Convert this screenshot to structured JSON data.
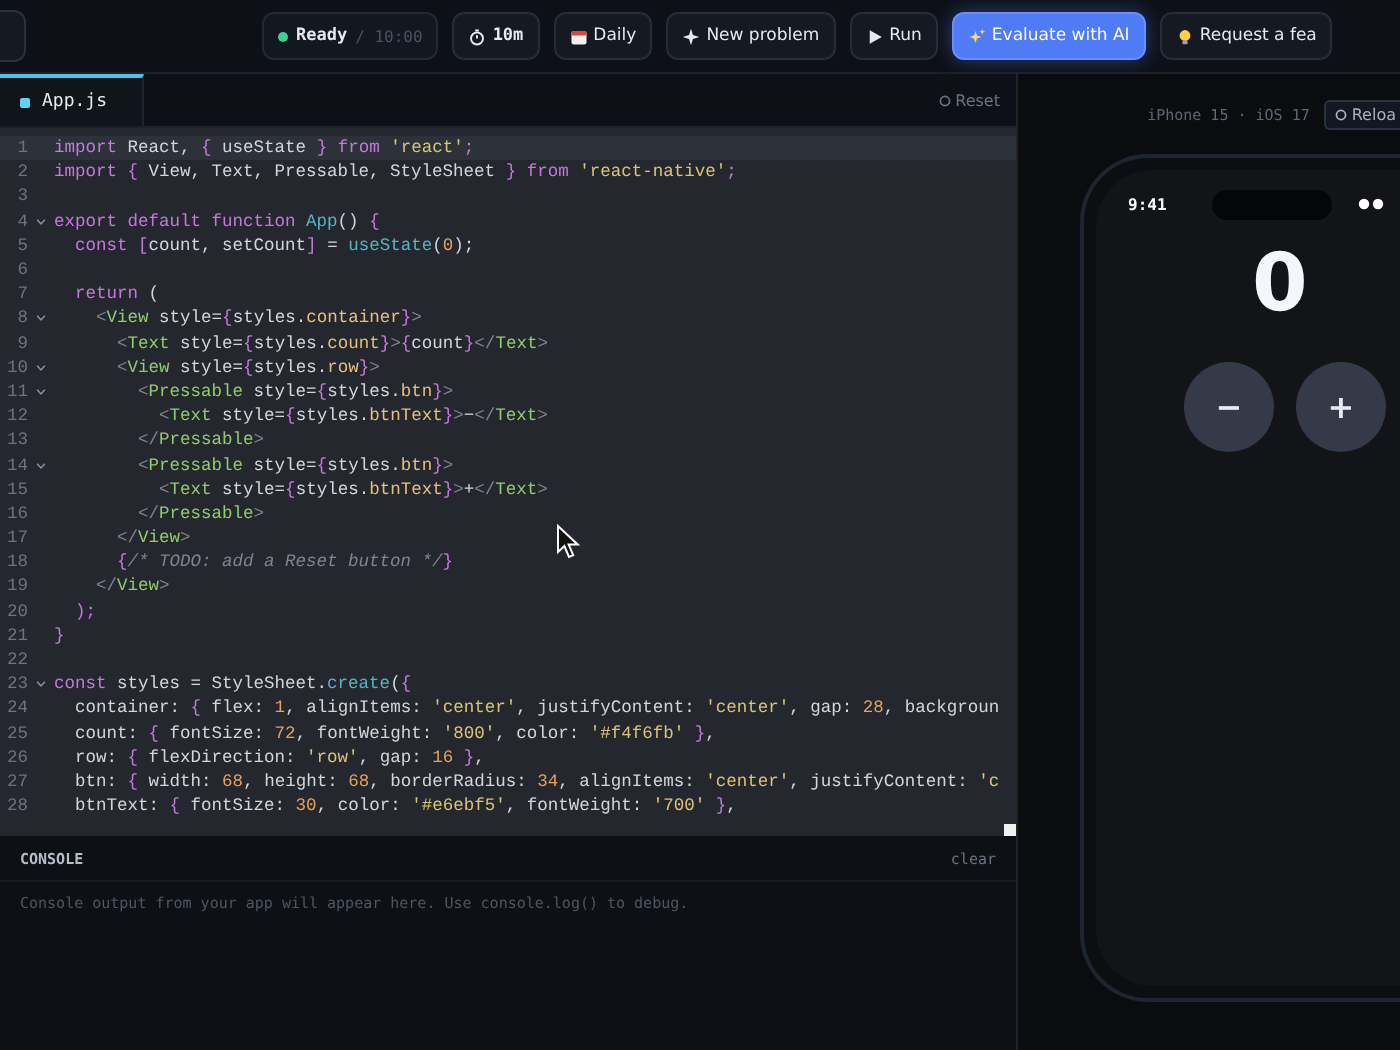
{
  "toolbar": {
    "status": {
      "label": "Ready",
      "limit": "/ 10:00",
      "color": "#3ecf8e"
    },
    "buttons": [
      {
        "label": "10m",
        "kind": "mono"
      },
      {
        "label": "Daily",
        "kind": "plain"
      },
      {
        "label": "New problem",
        "kind": "plain"
      },
      {
        "label": "Run",
        "kind": "plain"
      },
      {
        "label": "Evaluate with AI",
        "kind": "primary"
      },
      {
        "label": "Request a fea",
        "kind": "plain"
      }
    ]
  },
  "editor": {
    "tabs": [
      {
        "label": "App.js",
        "selected": true
      }
    ],
    "reset": "Reset",
    "lines": [
      {
        "n": "1",
        "fold": false,
        "current": true,
        "tokens": [
          {
            "kind": "k",
            "text": "import "
          },
          {
            "kind": "i",
            "text": "React, "
          },
          {
            "kind": "p",
            "text": "{ "
          },
          {
            "kind": "i",
            "text": "useState "
          },
          {
            "kind": "p",
            "text": "} "
          },
          {
            "kind": "k",
            "text": "from "
          },
          {
            "kind": "s",
            "text": "'react'"
          },
          {
            "kind": "p",
            "text": ";"
          }
        ]
      },
      {
        "n": "2",
        "fold": false,
        "current": false,
        "tokens": [
          {
            "kind": "k",
            "text": "import "
          },
          {
            "kind": "p",
            "text": "{ "
          },
          {
            "kind": "i",
            "text": "View, Text, Pressable, StyleSheet "
          },
          {
            "kind": "p",
            "text": "} "
          },
          {
            "kind": "k",
            "text": "from "
          },
          {
            "kind": "s",
            "text": "'react-native'"
          },
          {
            "kind": "p",
            "text": ";"
          }
        ]
      },
      {
        "n": "3",
        "fold": false,
        "current": false
      },
      {
        "n": "4",
        "fold": true,
        "current": false,
        "tokens": [
          {
            "kind": "k",
            "text": "export default function "
          },
          {
            "kind": "f",
            "text": "App"
          },
          {
            "kind": "i",
            "text": "() "
          },
          {
            "kind": "p",
            "text": "{"
          }
        ]
      },
      {
        "n": "5",
        "fold": false,
        "current": false,
        "tokens": [
          {
            "kind": "k",
            "text": "  const "
          },
          {
            "kind": "p",
            "text": "["
          },
          {
            "kind": "i",
            "text": "count, setCount"
          },
          {
            "kind": "p",
            "text": "] "
          },
          {
            "kind": "i",
            "text": "= "
          },
          {
            "kind": "f",
            "text": "useState"
          },
          {
            "kind": "i",
            "text": "("
          },
          {
            "kind": "n",
            "text": "0"
          },
          {
            "kind": "i",
            "text": ");"
          }
        ]
      },
      {
        "n": "6",
        "fold": false,
        "current": false
      },
      {
        "n": "7",
        "fold": false,
        "current": false,
        "tokens": [
          {
            "kind": "k",
            "text": "  return "
          },
          {
            "kind": "i",
            "text": "("
          }
        ]
      },
      {
        "n": "8",
        "fold": true,
        "current": false,
        "tokens": [
          {
            "kind": "a",
            "text": "    <"
          },
          {
            "kind": "t",
            "text": "View "
          },
          {
            "kind": "i",
            "text": "style="
          },
          {
            "kind": "p",
            "text": "{"
          },
          {
            "kind": "i",
            "text": "styles."
          },
          {
            "kind": "y",
            "text": "container"
          },
          {
            "kind": "p",
            "text": "}"
          },
          {
            "kind": "a",
            "text": ">"
          }
        ]
      },
      {
        "n": "9",
        "fold": false,
        "current": false,
        "tokens": [
          {
            "kind": "a",
            "text": "      <"
          },
          {
            "kind": "t",
            "text": "Text "
          },
          {
            "kind": "i",
            "text": "style="
          },
          {
            "kind": "p",
            "text": "{"
          },
          {
            "kind": "i",
            "text": "styles."
          },
          {
            "kind": "y",
            "text": "count"
          },
          {
            "kind": "p",
            "text": "}"
          },
          {
            "kind": "a",
            "text": ">"
          },
          {
            "kind": "p",
            "text": "{"
          },
          {
            "kind": "i",
            "text": "count"
          },
          {
            "kind": "p",
            "text": "}"
          },
          {
            "kind": "a",
            "text": "</"
          },
          {
            "kind": "t",
            "text": "Text"
          },
          {
            "kind": "a",
            "text": ">"
          }
        ]
      },
      {
        "n": "10",
        "fold": true,
        "current": false,
        "tokens": [
          {
            "kind": "a",
            "text": "      <"
          },
          {
            "kind": "t",
            "text": "View "
          },
          {
            "kind": "i",
            "text": "style="
          },
          {
            "kind": "p",
            "text": "{"
          },
          {
            "kind": "i",
            "text": "styles."
          },
          {
            "kind": "y",
            "text": "row"
          },
          {
            "kind": "p",
            "text": "}"
          },
          {
            "kind": "a",
            "text": ">"
          }
        ]
      },
      {
        "n": "11",
        "fold": true,
        "current": false,
        "tokens": [
          {
            "kind": "a",
            "text": "        <"
          },
          {
            "kind": "t",
            "text": "Pressable "
          },
          {
            "kind": "i",
            "text": "style="
          },
          {
            "kind": "p",
            "text": "{"
          },
          {
            "kind": "i",
            "text": "styles."
          },
          {
            "kind": "y",
            "text": "btn"
          },
          {
            "kind": "p",
            "text": "}"
          },
          {
            "kind": "a",
            "text": ">"
          }
        ]
      },
      {
        "n": "12",
        "fold": false,
        "current": false,
        "tokens": [
          {
            "kind": "a",
            "text": "          <"
          },
          {
            "kind": "t",
            "text": "Text "
          },
          {
            "kind": "i",
            "text": "style="
          },
          {
            "kind": "p",
            "text": "{"
          },
          {
            "kind": "i",
            "text": "styles."
          },
          {
            "kind": "y",
            "text": "btnText"
          },
          {
            "kind": "p",
            "text": "}"
          },
          {
            "kind": "a",
            "text": ">"
          },
          {
            "kind": "i",
            "text": "−"
          },
          {
            "kind": "a",
            "text": "</"
          },
          {
            "kind": "t",
            "text": "Text"
          },
          {
            "kind": "a",
            "text": ">"
          }
        ]
      },
      {
        "n": "13",
        "fold": false,
        "current": false,
        "tokens": [
          {
            "kind": "a",
            "text": "        </"
          },
          {
            "kind": "t",
            "text": "Pressable"
          },
          {
            "kind": "a",
            "text": ">"
          }
        ]
      },
      {
        "n": "14",
        "fold": true,
        "current": false,
        "tokens": [
          {
            "kind": "a",
            "text": "        <"
          },
          {
            "kind": "t",
            "text": "Pressable "
          },
          {
            "kind": "i",
            "text": "style="
          },
          {
            "kind": "p",
            "text": "{"
          },
          {
            "kind": "i",
            "text": "styles."
          },
          {
            "kind": "y",
            "text": "btn"
          },
          {
            "kind": "p",
            "text": "}"
          },
          {
            "kind": "a",
            "text": ">"
          }
        ]
      },
      {
        "n": "15",
        "fold": false,
        "current": false,
        "tokens": [
          {
            "kind": "a",
            "text": "          <"
          },
          {
            "kind": "t",
            "text": "Text "
          },
          {
            "kind": "i",
            "text": "style="
          },
          {
            "kind": "p",
            "text": "{"
          },
          {
            "kind": "i",
            "text": "styles."
          },
          {
            "kind": "y",
            "text": "btnText"
          },
          {
            "kind": "p",
            "text": "}"
          },
          {
            "kind": "a",
            "text": ">"
          },
          {
            "kind": "i",
            "text": "+"
          },
          {
            "kind": "a",
            "text": "</"
          },
          {
            "kind": "t",
            "text": "Text"
          },
          {
            "kind": "a",
            "text": ">"
          }
        ]
      },
      {
        "n": "16",
        "fold": false,
        "current": false,
        "tokens": [
          {
            "kind": "a",
            "text": "        </"
          },
          {
            "kind": "t",
            "text": "Pressable"
          },
          {
            "kind": "a",
            "text": ">"
          }
        ]
      },
      {
        "n": "17",
        "fold": false,
        "current": false,
        "tokens": [
          {
            "kind": "a",
            "text": "      </"
          },
          {
            "kind": "t",
            "text": "View"
          },
          {
            "kind": "a",
            "text": ">"
          }
        ]
      },
      {
        "n": "18",
        "fold": false,
        "current": false,
        "tokens": [
          {
            "kind": "p",
            "text": "      {"
          },
          {
            "kind": "c",
            "text": "/* TODO: add a Reset button */"
          },
          {
            "kind": "p",
            "text": "}"
          }
        ]
      },
      {
        "n": "19",
        "fold": false,
        "current": false,
        "tokens": [
          {
            "kind": "a",
            "text": "    </"
          },
          {
            "kind": "t",
            "text": "View"
          },
          {
            "kind": "a",
            "text": ">"
          }
        ]
      },
      {
        "n": "20",
        "fold": false,
        "current": false,
        "tokens": [
          {
            "kind": "p",
            "text": "  );"
          }
        ]
      },
      {
        "n": "21",
        "fold": false,
        "current": false,
        "tokens": [
          {
            "kind": "p",
            "text": "}"
          }
        ]
      },
      {
        "n": "22",
        "fold": false,
        "current": false
      },
      {
        "n": "23",
        "fold": true,
        "current": false,
        "tokens": [
          {
            "kind": "k",
            "text": "const "
          },
          {
            "kind": "i",
            "text": "styles = StyleSheet."
          },
          {
            "kind": "f",
            "text": "create"
          },
          {
            "kind": "i",
            "text": "("
          },
          {
            "kind": "p",
            "text": "{"
          }
        ]
      },
      {
        "n": "24",
        "fold": false,
        "current": false,
        "tokens": [
          {
            "kind": "i",
            "text": "  container: "
          },
          {
            "kind": "p",
            "text": "{ "
          },
          {
            "kind": "i",
            "text": "flex: "
          },
          {
            "kind": "n",
            "text": "1"
          },
          {
            "kind": "i",
            "text": ", alignItems: "
          },
          {
            "kind": "s",
            "text": "'center'"
          },
          {
            "kind": "i",
            "text": ", justifyContent: "
          },
          {
            "kind": "s",
            "text": "'center'"
          },
          {
            "kind": "i",
            "text": ", gap: "
          },
          {
            "kind": "n",
            "text": "28"
          },
          {
            "kind": "i",
            "text": ", backgroun"
          }
        ]
      },
      {
        "n": "25",
        "fold": false,
        "current": false,
        "tokens": [
          {
            "kind": "i",
            "text": "  count: "
          },
          {
            "kind": "p",
            "text": "{ "
          },
          {
            "kind": "i",
            "text": "fontSize: "
          },
          {
            "kind": "n",
            "text": "72"
          },
          {
            "kind": "i",
            "text": ", fontWeight: "
          },
          {
            "kind": "s",
            "text": "'800'"
          },
          {
            "kind": "i",
            "text": ", color: "
          },
          {
            "kind": "s",
            "text": "'#f4f6fb'"
          },
          {
            "kind": "p",
            "text": " }"
          },
          {
            "kind": "i",
            "text": ","
          }
        ]
      },
      {
        "n": "26",
        "fold": false,
        "current": false,
        "tokens": [
          {
            "kind": "i",
            "text": "  row: "
          },
          {
            "kind": "p",
            "text": "{ "
          },
          {
            "kind": "i",
            "text": "flexDirection: "
          },
          {
            "kind": "s",
            "text": "'row'"
          },
          {
            "kind": "i",
            "text": ", gap: "
          },
          {
            "kind": "n",
            "text": "16"
          },
          {
            "kind": "p",
            "text": " }"
          },
          {
            "kind": "i",
            "text": ","
          }
        ]
      },
      {
        "n": "27",
        "fold": false,
        "current": false,
        "tokens": [
          {
            "kind": "i",
            "text": "  btn: "
          },
          {
            "kind": "p",
            "text": "{ "
          },
          {
            "kind": "i",
            "text": "width: "
          },
          {
            "kind": "n",
            "text": "68"
          },
          {
            "kind": "i",
            "text": ", height: "
          },
          {
            "kind": "n",
            "text": "68"
          },
          {
            "kind": "i",
            "text": ", borderRadius: "
          },
          {
            "kind": "n",
            "text": "34"
          },
          {
            "kind": "i",
            "text": ", alignItems: "
          },
          {
            "kind": "s",
            "text": "'center'"
          },
          {
            "kind": "i",
            "text": ", justifyContent: "
          },
          {
            "kind": "s",
            "text": "'c"
          }
        ]
      },
      {
        "n": "28",
        "fold": false,
        "current": false,
        "tokens": [
          {
            "kind": "i",
            "text": "  btnText: "
          },
          {
            "kind": "p",
            "text": "{ "
          },
          {
            "kind": "i",
            "text": "fontSize: "
          },
          {
            "kind": "n",
            "text": "30"
          },
          {
            "kind": "i",
            "text": ", color: "
          },
          {
            "kind": "s",
            "text": "'#e6ebf5'"
          },
          {
            "kind": "i",
            "text": ", fontWeight: "
          },
          {
            "kind": "s",
            "text": "'700'"
          },
          {
            "kind": "p",
            "text": " }"
          },
          {
            "kind": "i",
            "text": ","
          }
        ]
      }
    ]
  },
  "console": {
    "title": "CONSOLE",
    "clear": "clear",
    "placeholder": "Console output from your app will appear here. Use console.log() to debug."
  },
  "preview": {
    "device": "iPhone 15 · iOS 17",
    "reload": "Reloa",
    "phone": {
      "time": "9:41",
      "count": "0",
      "buttons": [
        "−",
        "+"
      ]
    }
  }
}
